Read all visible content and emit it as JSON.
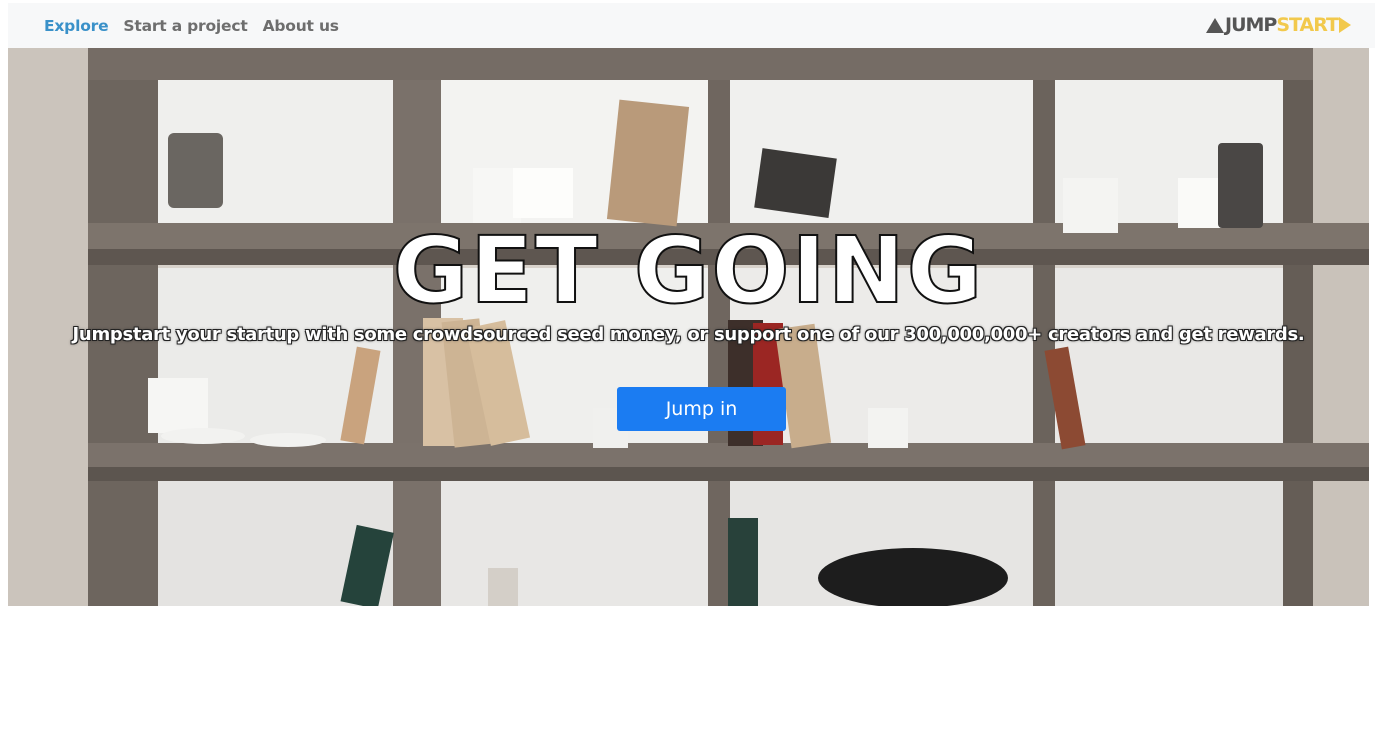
{
  "nav": {
    "links": [
      {
        "label": "Explore",
        "active": true
      },
      {
        "label": "Start a project",
        "active": false
      },
      {
        "label": "About us",
        "active": false
      }
    ]
  },
  "logo": {
    "part1": "JUMP",
    "part2": "START",
    "colors": {
      "jump": "#555555",
      "start": "#f2c94c"
    }
  },
  "hero": {
    "title": "GET GOING",
    "subtitle": "Jumpstart your startup with some crowdsourced seed money, or support one of our 300,000,000+ creators and get rewards.",
    "cta_label": "Jump in"
  },
  "colors": {
    "nav_active": "#3a91c9",
    "nav_text": "#6e6e6e",
    "cta_bg": "#1b7cf2"
  }
}
